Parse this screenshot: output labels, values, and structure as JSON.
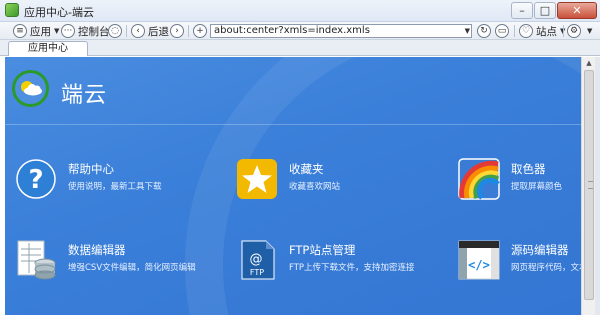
{
  "window": {
    "title": "应用中心-端云",
    "minimize": "–",
    "maximize": "□",
    "close": "✕"
  },
  "toolbar": {
    "apps_label": "应用",
    "console_label": "控制台",
    "back_label": "后退",
    "address": "about:center?xmls=index.xmls",
    "sites_label": "站点"
  },
  "tabs": [
    {
      "label": "应用中心"
    }
  ],
  "brand": {
    "name": "端云"
  },
  "apps": [
    {
      "name": "帮助中心",
      "desc": "使用说明，最新工具下载",
      "icon": "help-icon"
    },
    {
      "name": "收藏夹",
      "desc": "收藏喜欢网站",
      "icon": "star-icon"
    },
    {
      "name": "取色器",
      "desc": "提取屏幕颜色",
      "icon": "rainbow-icon"
    },
    {
      "name": "数据编辑器",
      "desc": "增强CSV文件编辑，简化网页编辑",
      "icon": "database-icon"
    },
    {
      "name": "FTP站点管理",
      "desc": "FTP上传下载文件，支持加密连接",
      "icon": "ftp-icon"
    },
    {
      "name": "源码编辑器",
      "desc": "网页程序代码，文本",
      "icon": "code-editor-icon"
    }
  ],
  "icons": {
    "ftp_text": "FTP",
    "help_glyph": "?"
  },
  "colors": {
    "content_bg": "#3a7fd9",
    "brand_ring": "#2a9a2a"
  }
}
